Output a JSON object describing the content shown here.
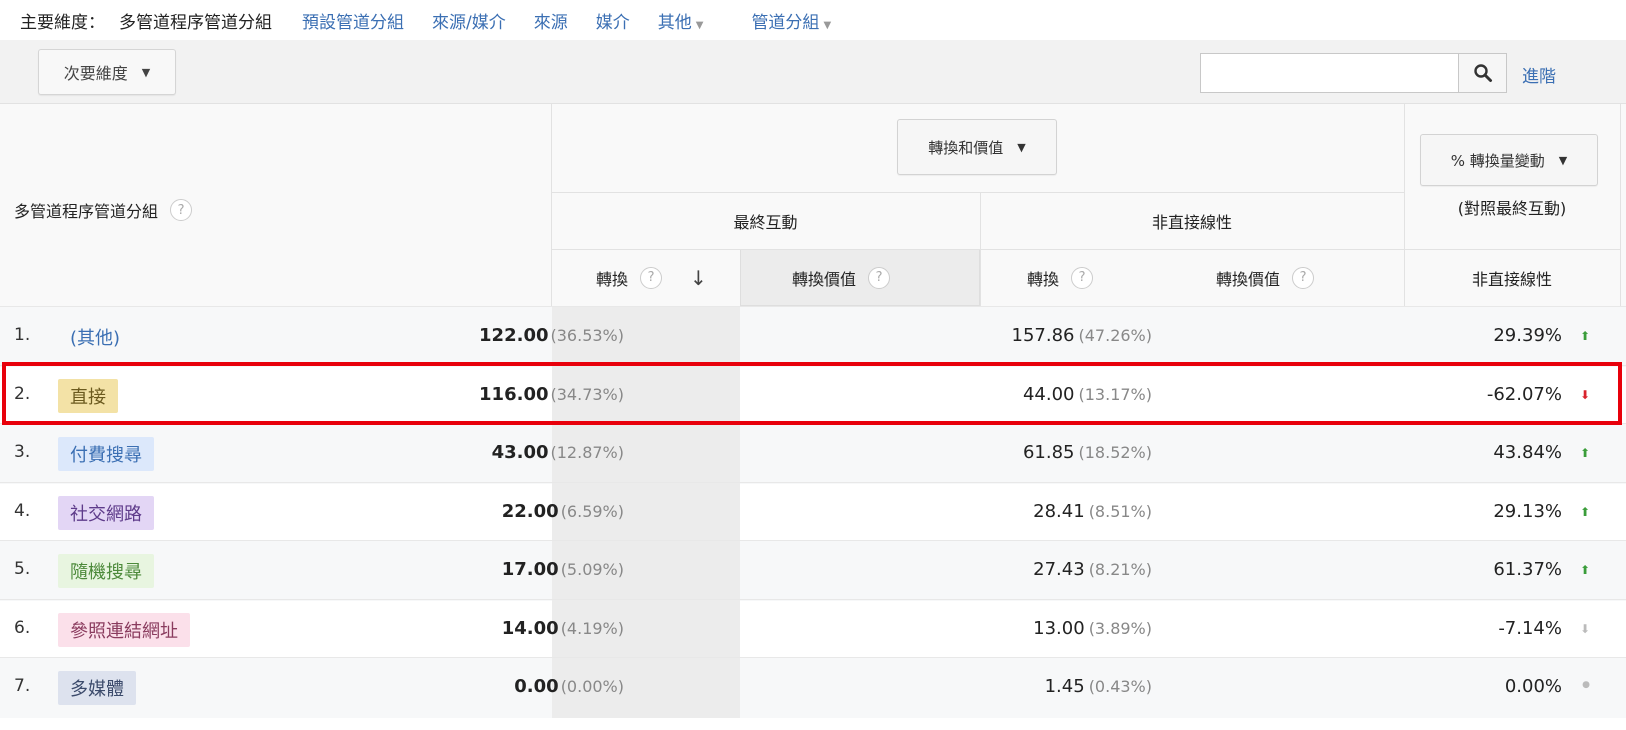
{
  "dimension_bar": {
    "label": "主要維度：",
    "active": "多管道程序管道分組",
    "links": [
      "預設管道分組",
      "來源/媒介",
      "來源",
      "媒介"
    ],
    "other": "其他",
    "channel_group": "管道分組"
  },
  "toolbar": {
    "secondary_dimension": "次要維度",
    "search_placeholder": "",
    "advanced": "進階"
  },
  "table": {
    "dimension_header": "多管道程序管道分組",
    "metric_dropdown": "轉換和價值",
    "group_last": "最終互動",
    "group_nonlinear": "非直接線性",
    "compare_dropdown": "% 轉換量變動",
    "compare_sub": "(對照最終互動)",
    "col_conv": "轉換",
    "col_value": "轉換價值",
    "col_conv2": "轉換",
    "col_value2": "轉換價值",
    "col_change": "非直接線性",
    "help": "?"
  },
  "rows": [
    {
      "num": "1.",
      "name": "(其他)",
      "last": "122.00",
      "last_pct": "(36.53%)",
      "nl": "157.86",
      "nl_pct": "(47.26%)",
      "change": "29.39%",
      "trend": "up"
    },
    {
      "num": "2.",
      "name": "直接",
      "last": "116.00",
      "last_pct": "(34.73%)",
      "nl": "44.00",
      "nl_pct": "(13.17%)",
      "change": "-62.07%",
      "trend": "down"
    },
    {
      "num": "3.",
      "name": "付費搜尋",
      "last": "43.00",
      "last_pct": "(12.87%)",
      "nl": "61.85",
      "nl_pct": "(18.52%)",
      "change": "43.84%",
      "trend": "up"
    },
    {
      "num": "4.",
      "name": "社交網路",
      "last": "22.00",
      "last_pct": "(6.59%)",
      "nl": "28.41",
      "nl_pct": "(8.51%)",
      "change": "29.13%",
      "trend": "up"
    },
    {
      "num": "5.",
      "name": "隨機搜尋",
      "last": "17.00",
      "last_pct": "(5.09%)",
      "nl": "27.43",
      "nl_pct": "(8.21%)",
      "change": "61.37%",
      "trend": "up"
    },
    {
      "num": "6.",
      "name": "參照連結網址",
      "last": "14.00",
      "last_pct": "(4.19%)",
      "nl": "13.00",
      "nl_pct": "(3.89%)",
      "change": "-7.14%",
      "trend": "down-small"
    },
    {
      "num": "7.",
      "name": "多媒體",
      "last": "0.00",
      "last_pct": "(0.00%)",
      "nl": "1.45",
      "nl_pct": "(0.43%)",
      "change": "0.00%",
      "trend": "flat"
    }
  ],
  "colors": {
    "link": "#3b6fb3",
    "up": "#3a9d3a",
    "down": "#d9232d",
    "highlight": "#e8000b"
  }
}
